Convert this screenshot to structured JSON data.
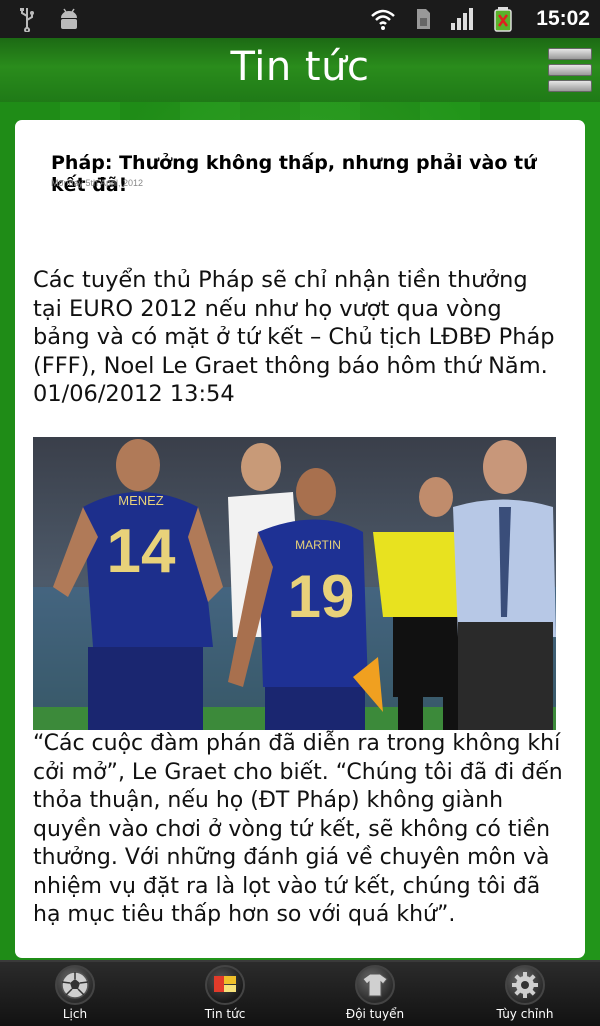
{
  "status_bar": {
    "time": "15:02",
    "icons": [
      "usb-icon",
      "android-debug-icon",
      "wifi-icon",
      "sim-icon",
      "signal-icon",
      "battery-icon"
    ]
  },
  "header": {
    "title": "Tin tức",
    "menu_icon": "menu-icon"
  },
  "article": {
    "headline": "Pháp: Thưởng không thấp, nhưng phải vào tứ kết đã!",
    "date": "Monday 5th April, 2012",
    "lead": "Các tuyển thủ Pháp sẽ chỉ nhận tiền thưởng tại EURO 2012 nếu như họ vượt qua vòng bảng và có mặt ở tứ kết – Chủ tịch LĐBĐ Pháp (FFF), Noel Le Graet thông báo hôm thứ Năm. 01/06/2012 13:54",
    "photo_numbers": [
      "MENEZ",
      "14",
      "MARTIN",
      "19"
    ],
    "body": "“Các cuộc đàm phán đã diễn ra trong không khí cởi mở”, Le Graet cho biết. “Chúng tôi đã đi đến thỏa thuận, nếu họ (ĐT Pháp) không giành quyền vào chơi ở vòng tứ kết, sẽ không có tiền thưởng. Với những đánh giá về chuyên môn và nhiệm vụ đặt ra là lọt vào tứ kết, chúng tôi đã hạ mục tiêu thấp hơn so với quá khứ”."
  },
  "bottom_nav": {
    "items": [
      {
        "label": "Lịch",
        "icon": "soccer-ball-icon"
      },
      {
        "label": "Tin tức",
        "icon": "news-icon",
        "active": true
      },
      {
        "label": "Đội tuyển",
        "icon": "jersey-icon"
      },
      {
        "label": "Tùy chỉnh",
        "icon": "settings-gear-icon"
      }
    ]
  },
  "colors": {
    "field_green": "#1e8a16",
    "status_bar": "#1b1b1b",
    "nav_bar": "#1a1a1a"
  }
}
